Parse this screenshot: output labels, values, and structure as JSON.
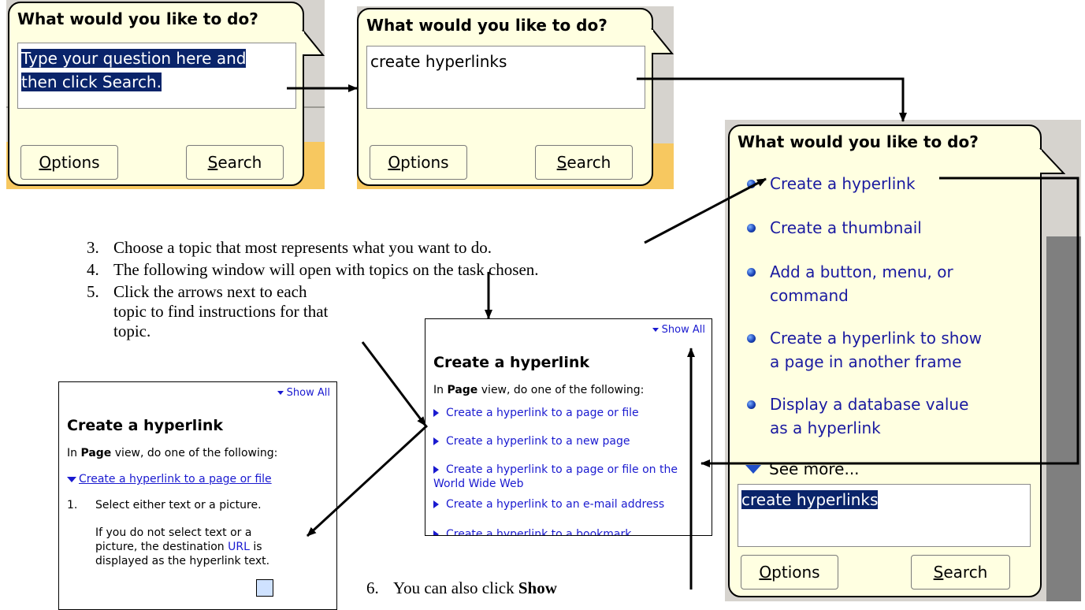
{
  "colors": {
    "balloon": "#ffffe1",
    "selection": "#0a246a",
    "link": "#1a1ad0",
    "orange_bar": "#f7c860"
  },
  "balloon1": {
    "title": "What would you like to do?",
    "query_line1": "Type your question here and",
    "query_line2": "then click Search.",
    "options": "Options",
    "options_rest": "ptions",
    "options_key": "O",
    "search_key": "S",
    "search_rest": "earch"
  },
  "balloon2": {
    "title": "What would you like to do?",
    "query": "create hyperlinks",
    "options_key": "O",
    "options_rest": "ptions",
    "search_key": "S",
    "search_rest": "earch"
  },
  "balloon3": {
    "title": "What would you like to do?",
    "topics": [
      {
        "line1": "Create a hyperlink",
        "line2": ""
      },
      {
        "line1": "Create a thumbnail",
        "line2": ""
      },
      {
        "line1": "Add a button, menu, or",
        "line2": "command"
      },
      {
        "line1": "Create a hyperlink to show",
        "line2": "a page in another frame"
      },
      {
        "line1": "Display a database value",
        "line2": "as a hyperlink"
      }
    ],
    "see_more": "See more...",
    "query": "create hyperlinks",
    "options_key": "O",
    "options_rest": "ptions",
    "search_key": "S",
    "search_rest": "earch"
  },
  "steps": {
    "s3_num": "3.",
    "s3": "Choose a topic that most represents what you want to do.",
    "s4_num": "4.",
    "s4": "The following window will open with topics on the task chosen.",
    "s5_num": "5.",
    "s5_l1": "Click the arrows next to each",
    "s5_l2": "topic to find instructions for that",
    "s5_l3": "topic.",
    "s6_num": "6.",
    "s6_pre": "You can also click ",
    "s6_bold": "Show"
  },
  "pane_right": {
    "show_all": "Show All",
    "heading": "Create a hyperlink",
    "intro_pre": "In ",
    "intro_bold": "Page",
    "intro_post": " view, do one of the following:",
    "links": [
      "Create a hyperlink to a page or file",
      "Create a hyperlink to a new page",
      "Create a hyperlink to a page or file on the World Wide Web",
      "Create a hyperlink to an e-mail address",
      "Create a hyperlink to a bookmark"
    ]
  },
  "pane_left": {
    "show_all": "Show All",
    "heading": "Create a hyperlink",
    "intro_pre": "In ",
    "intro_bold": "Page",
    "intro_post": " view, do one of the following:",
    "expanded_link": "Create a hyperlink to a page or file",
    "step_num": "1.",
    "step_text": "Select either text or a picture.",
    "para_pre": "If you do not select text or a picture, the destination ",
    "para_url": "URL",
    "para_post": " is displayed as the hyperlink text."
  }
}
